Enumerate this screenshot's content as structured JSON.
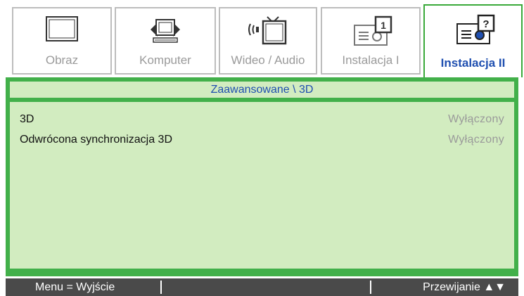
{
  "tabs": [
    {
      "label": "Obraz",
      "icon": "monitor-icon",
      "active": false
    },
    {
      "label": "Komputer",
      "icon": "computer-icon",
      "active": false
    },
    {
      "label": "Wideo / Audio",
      "icon": "video-audio-icon",
      "active": false
    },
    {
      "label": "Instalacja I",
      "icon": "projector-icon",
      "active": false
    },
    {
      "label": "Instalacja II",
      "icon": "projector-question-icon",
      "active": true
    }
  ],
  "subheader": {
    "title": "Zaawansowane \\ 3D"
  },
  "settings": [
    {
      "name": "3D",
      "value": "Wyłączony"
    },
    {
      "name": "Odwrócona synchronizacja 3D",
      "value": "Wyłączony"
    }
  ],
  "footer": {
    "left": "Menu = Wyjście",
    "right": "Przewijanie ▲▼"
  },
  "colors": {
    "accent_green": "#42b04a",
    "panel_green": "#d2ecc0",
    "active_label": "#1f4fb0",
    "inactive_label": "#9a9a9a",
    "footer_bg": "#4a4a4a"
  }
}
